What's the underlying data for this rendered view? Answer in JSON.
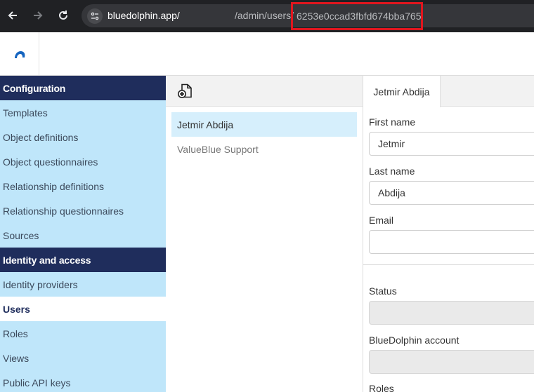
{
  "browser": {
    "domain": "bluedolphin.app/",
    "path": "/admin/users/",
    "record_id": "6253e0ccad3fbfd674bba765",
    "highlight_color": "#e0161e"
  },
  "sidebar": {
    "sections": [
      {
        "heading": "Configuration",
        "items": [
          "Templates",
          "Object definitions",
          "Object questionnaires",
          "Relationship definitions",
          "Relationship questionnaires",
          "Sources"
        ]
      },
      {
        "heading": "Identity and access",
        "items": [
          "Identity providers",
          "Users",
          "Roles",
          "Views",
          "Public API keys"
        ]
      }
    ],
    "active_item": "Users"
  },
  "users_list": {
    "add_icon": "add-document-icon",
    "items": [
      "Jetmir Abdija",
      "ValueBlue Support"
    ],
    "selected": "Jetmir Abdija"
  },
  "detail": {
    "tab_label": "Jetmir Abdija",
    "first_name_label": "First name",
    "first_name_value": "Jetmir",
    "last_name_label": "Last name",
    "last_name_value": "Abdija",
    "email_label": "Email",
    "email_value": "",
    "status_label": "Status",
    "status_value": "",
    "account_label": "BlueDolphin account",
    "account_value": "",
    "roles_label": "Roles"
  },
  "colors": {
    "sidebar_bg": "#bfe6fa",
    "sidebar_heading": "#1f2d5c",
    "selected_row": "#d6effc"
  }
}
